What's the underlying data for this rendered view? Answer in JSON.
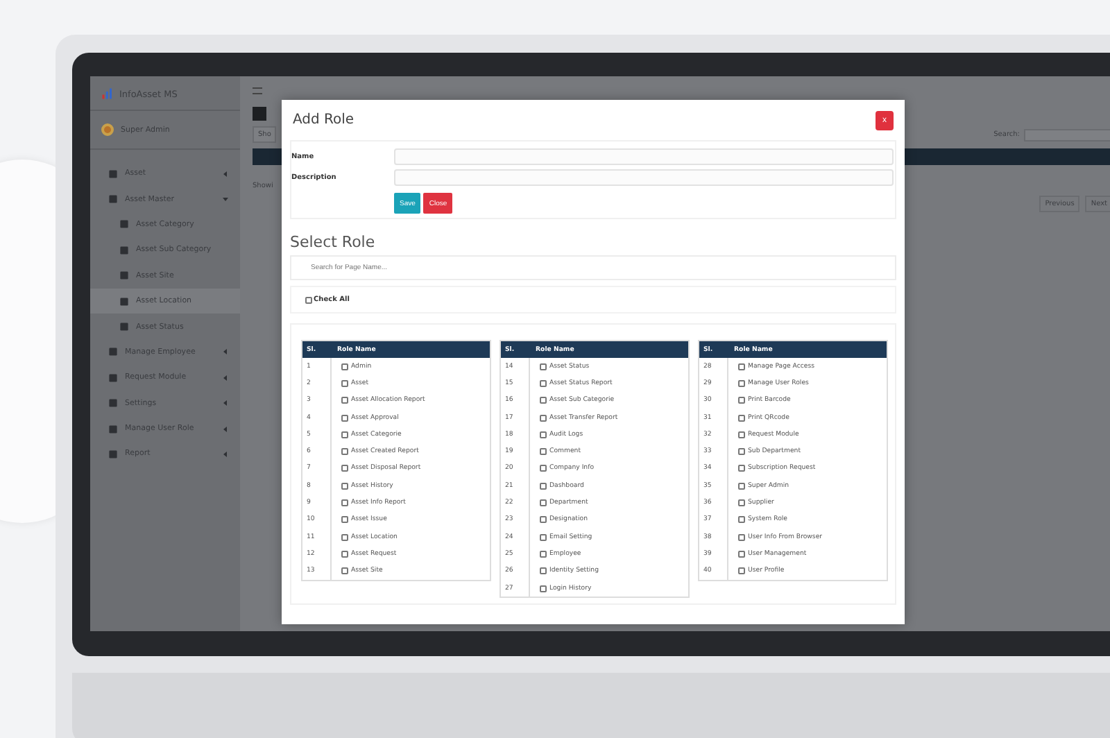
{
  "app": {
    "logo_text": "InfoAsset MS",
    "user": "Super Admin"
  },
  "sidebar": {
    "items": [
      {
        "label": "Asset",
        "expanded": false
      },
      {
        "label": "Asset Master",
        "expanded": true,
        "children": [
          {
            "label": "Asset Category",
            "selected": false
          },
          {
            "label": "Asset Sub Category",
            "selected": false
          },
          {
            "label": "Asset Site",
            "selected": false
          },
          {
            "label": "Asset Location",
            "selected": true
          },
          {
            "label": "Asset Status",
            "selected": false
          }
        ]
      },
      {
        "label": "Manage Employee",
        "expanded": false
      },
      {
        "label": "Request Module",
        "expanded": false
      },
      {
        "label": "Settings",
        "expanded": false
      },
      {
        "label": "Manage User Role",
        "expanded": false
      },
      {
        "label": "Report",
        "expanded": false
      }
    ]
  },
  "background_page": {
    "show_label": "Sho",
    "search_label": "Search:",
    "info_text": "Showi",
    "pagination": [
      "Previous",
      "Next"
    ]
  },
  "modal": {
    "title": "Add Role",
    "close_button": "x",
    "fields": [
      {
        "label": "Name"
      },
      {
        "label": "Description"
      }
    ],
    "buttons": [
      {
        "label": "Save",
        "kind": "primary"
      },
      {
        "label": "Close",
        "kind": "danger"
      }
    ],
    "section_title": "Select Role",
    "search": {
      "placeholder": "Search for Page Name..."
    },
    "check_all": {
      "label": "Check All",
      "checked": false
    },
    "tables": [
      {
        "columns": [
          "Sl.",
          "Role Name"
        ],
        "rows": [
          {
            "sl": "1",
            "role_name": "Admin",
            "checked": false
          },
          {
            "sl": "2",
            "role_name": "Asset",
            "checked": false
          },
          {
            "sl": "3",
            "role_name": "Asset Allocation Report",
            "checked": false
          },
          {
            "sl": "4",
            "role_name": "Asset Approval",
            "checked": false
          },
          {
            "sl": "5",
            "role_name": "Asset Categorie",
            "checked": false
          },
          {
            "sl": "6",
            "role_name": "Asset Created Report",
            "checked": false
          },
          {
            "sl": "7",
            "role_name": "Asset Disposal Report",
            "checked": false
          },
          {
            "sl": "8",
            "role_name": "Asset History",
            "checked": false
          },
          {
            "sl": "9",
            "role_name": "Asset Info Report",
            "checked": false
          },
          {
            "sl": "10",
            "role_name": "Asset Issue",
            "checked": false
          },
          {
            "sl": "11",
            "role_name": "Asset Location",
            "checked": false
          },
          {
            "sl": "12",
            "role_name": "Asset Request",
            "checked": false
          },
          {
            "sl": "13",
            "role_name": "Asset Site",
            "checked": false
          }
        ]
      },
      {
        "columns": [
          "Sl.",
          "Role Name"
        ],
        "rows": [
          {
            "sl": "14",
            "role_name": "Asset Status",
            "checked": false
          },
          {
            "sl": "15",
            "role_name": "Asset Status Report",
            "checked": false
          },
          {
            "sl": "16",
            "role_name": "Asset Sub Categorie",
            "checked": false
          },
          {
            "sl": "17",
            "role_name": "Asset Transfer Report",
            "checked": false
          },
          {
            "sl": "18",
            "role_name": "Audit Logs",
            "checked": false
          },
          {
            "sl": "19",
            "role_name": "Comment",
            "checked": false
          },
          {
            "sl": "20",
            "role_name": "Company Info",
            "checked": false
          },
          {
            "sl": "21",
            "role_name": "Dashboard",
            "checked": false
          },
          {
            "sl": "22",
            "role_name": "Department",
            "checked": false
          },
          {
            "sl": "23",
            "role_name": "Designation",
            "checked": false
          },
          {
            "sl": "24",
            "role_name": "Email Setting",
            "checked": false
          },
          {
            "sl": "25",
            "role_name": "Employee",
            "checked": false
          },
          {
            "sl": "26",
            "role_name": "Identity Setting",
            "checked": false
          },
          {
            "sl": "27",
            "role_name": "Login History",
            "checked": false
          }
        ]
      },
      {
        "columns": [
          "Sl.",
          "Role Name"
        ],
        "rows": [
          {
            "sl": "28",
            "role_name": "Manage Page Access",
            "checked": false
          },
          {
            "sl": "29",
            "role_name": "Manage User Roles",
            "checked": false
          },
          {
            "sl": "30",
            "role_name": "Print Barcode",
            "checked": false
          },
          {
            "sl": "31",
            "role_name": "Print QRcode",
            "checked": false
          },
          {
            "sl": "32",
            "role_name": "Request Module",
            "checked": false
          },
          {
            "sl": "33",
            "role_name": "Sub Department",
            "checked": false
          },
          {
            "sl": "34",
            "role_name": "Subscription Request",
            "checked": false
          },
          {
            "sl": "35",
            "role_name": "Super Admin",
            "checked": false
          },
          {
            "sl": "36",
            "role_name": "Supplier",
            "checked": false
          },
          {
            "sl": "37",
            "role_name": "System Role",
            "checked": false
          },
          {
            "sl": "38",
            "role_name": "User Info From Browser",
            "checked": false
          },
          {
            "sl": "39",
            "role_name": "User Management",
            "checked": false
          },
          {
            "sl": "40",
            "role_name": "User Profile",
            "checked": false
          }
        ]
      }
    ]
  }
}
